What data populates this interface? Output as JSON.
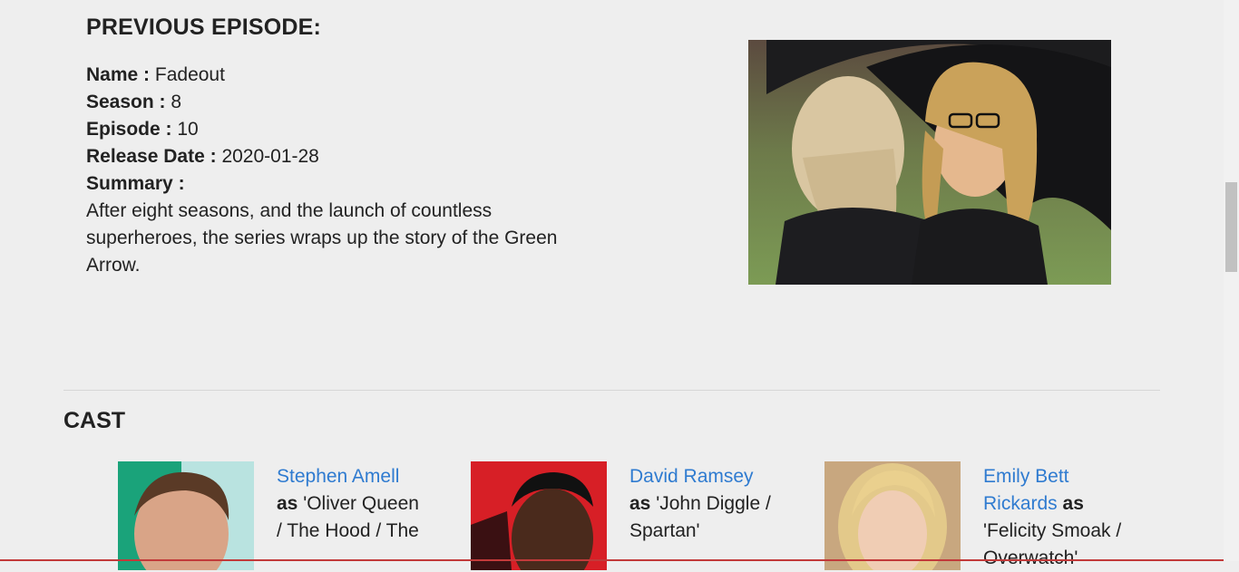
{
  "previous_episode": {
    "heading": "PREVIOUS EPISODE:",
    "name_label": "Name",
    "name_value": "Fadeout",
    "season_label": "Season",
    "season_value": "8",
    "episode_label": "Episode",
    "episode_value": "10",
    "release_label": "Release Date",
    "release_value": "2020-01-28",
    "summary_label": "Summary",
    "summary_text": "After eight seasons, and the launch of countless superheroes, the series wraps up the story of the Green Arrow.",
    "separator": ":"
  },
  "cast": {
    "heading": "CAST",
    "as_word": "as",
    "members": [
      {
        "actor": "Stephen Amell",
        "role": "'Oliver Queen / The Hood / The"
      },
      {
        "actor": "David Ramsey",
        "role": "'John Diggle / Spartan'"
      },
      {
        "actor": "Emily Bett Rickards",
        "role": "'Felicity Smoak / Overwatch'"
      }
    ]
  },
  "colors": {
    "link": "#2f7bd0",
    "background": "#eeeeee",
    "text": "#222222"
  }
}
